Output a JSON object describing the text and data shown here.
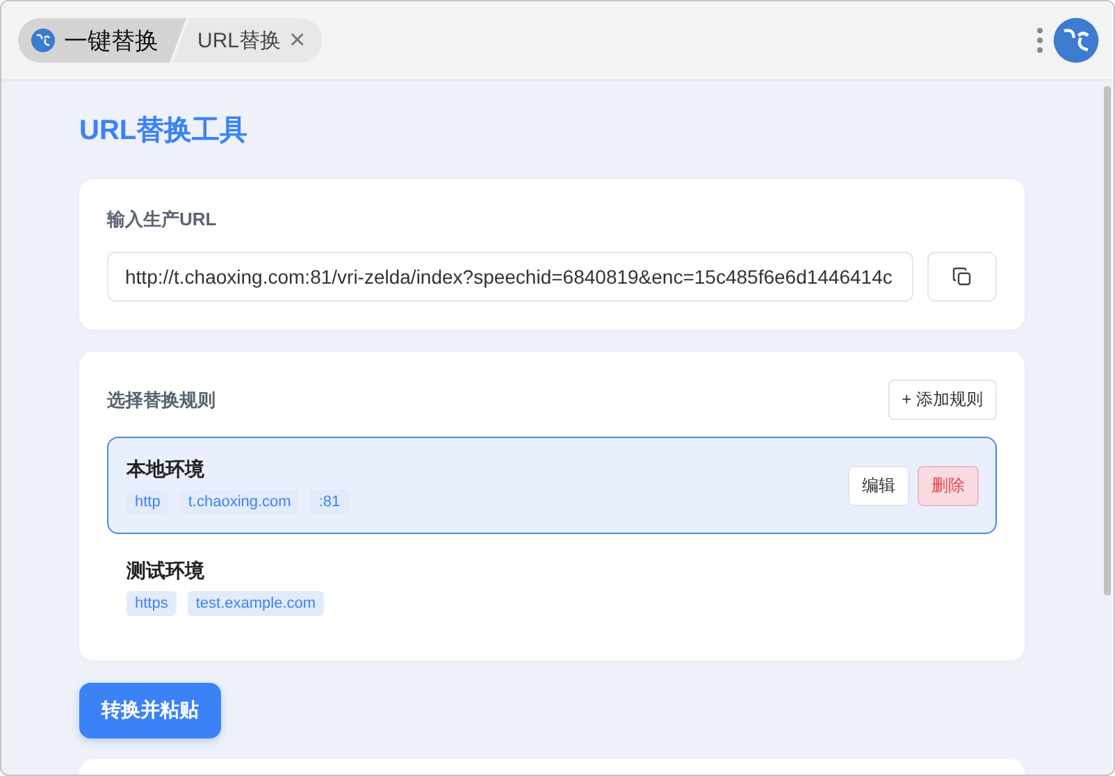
{
  "tabs": [
    {
      "label": "一键替换",
      "kind": "app",
      "selected": true
    },
    {
      "label": "URL替换",
      "kind": "page",
      "selected": false,
      "close": "×"
    }
  ],
  "page_title": "URL替换工具",
  "input_section": {
    "label": "输入生产URL",
    "value": "http://t.chaoxing.com:81/vri-zelda/index?speechid=6840819&enc=15c485f6e6d1446414c"
  },
  "rules_section": {
    "label": "选择替换规则",
    "add_button": "+ 添加规则",
    "rules": [
      {
        "name": "本地环境",
        "tags": [
          "http",
          "t.chaoxing.com",
          ":81"
        ],
        "selected": true,
        "actions": [
          {
            "label": "编辑",
            "kind": "edit"
          },
          {
            "label": "删除",
            "kind": "delete"
          }
        ]
      },
      {
        "name": "测试环境",
        "tags": [
          "https",
          "test.example.com"
        ],
        "selected": false
      }
    ]
  },
  "convert_button": "转换并粘贴"
}
